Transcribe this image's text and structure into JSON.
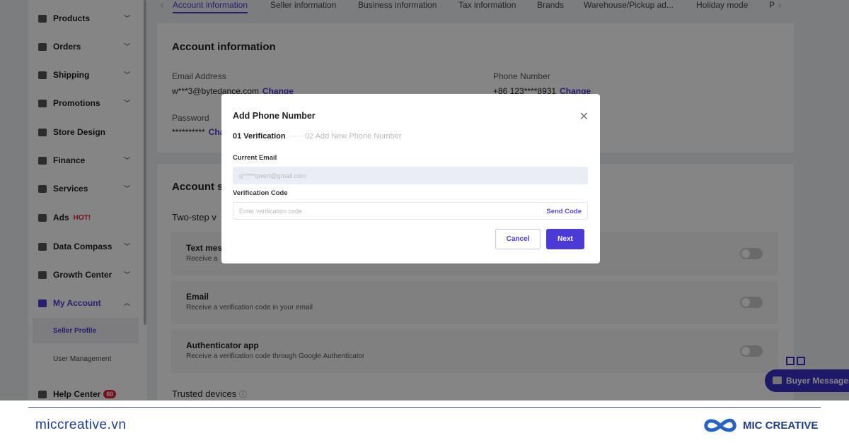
{
  "sidebar": {
    "items": [
      {
        "label": "Products",
        "chev": true
      },
      {
        "label": "Orders",
        "chev": true
      },
      {
        "label": "Shipping",
        "chev": true
      },
      {
        "label": "Promotions",
        "chev": true
      },
      {
        "label": "Store Design",
        "chev": false
      },
      {
        "label": "Finance",
        "chev": true
      },
      {
        "label": "Services",
        "chev": true
      },
      {
        "label": "Ads",
        "chev": false
      },
      {
        "label": "Data Compass",
        "chev": true
      },
      {
        "label": "Growth Center",
        "chev": true
      },
      {
        "label": "My Account",
        "chev": true
      }
    ],
    "ads_badge": "HOT!",
    "sub_items": [
      "Seller Profile",
      "User Management"
    ],
    "help": "Help Center",
    "help_badge": "60"
  },
  "tabs": [
    "Account information",
    "Seller information",
    "Business information",
    "Tax information",
    "Brands",
    "Warehouse/Pickup ad...",
    "Holiday mode",
    "P"
  ],
  "account": {
    "title": "Account information",
    "email_label": "Email Address",
    "email": "w***3@bytedance.com",
    "change": "Change",
    "phone_label": "Phone Number",
    "phone": "+86 123****8931",
    "password_label": "Password",
    "password": "**********",
    "password_change": "Cha"
  },
  "security": {
    "title": "Account s",
    "two_step": "Two-step v",
    "options": [
      {
        "title": "Text mes",
        "desc": "Receive a"
      },
      {
        "title": "Email",
        "desc": "Receive a verification code in your email"
      },
      {
        "title": "Authenticator app",
        "desc": "Receive a verification code through Google Authenticator"
      }
    ],
    "trusted": "Trusted devices"
  },
  "buyer_messages": "Buyer Messages",
  "modal": {
    "title": "Add Phone Number",
    "step1": "01 Verification",
    "step2": "02 Add New Phone Number",
    "email_label": "Current Email",
    "email_value": "q*****qwert@gmail.com",
    "code_label": "Verification Code",
    "code_placeholder": "Enter verification code",
    "send_code": "Send Code",
    "cancel": "Cancel",
    "next": "Next"
  },
  "footer": {
    "site": "miccreative.vn",
    "brand": "MIC CREATIVE"
  },
  "colors": {
    "accent": "#4b3ad6",
    "brand": "#1f3d8a"
  }
}
